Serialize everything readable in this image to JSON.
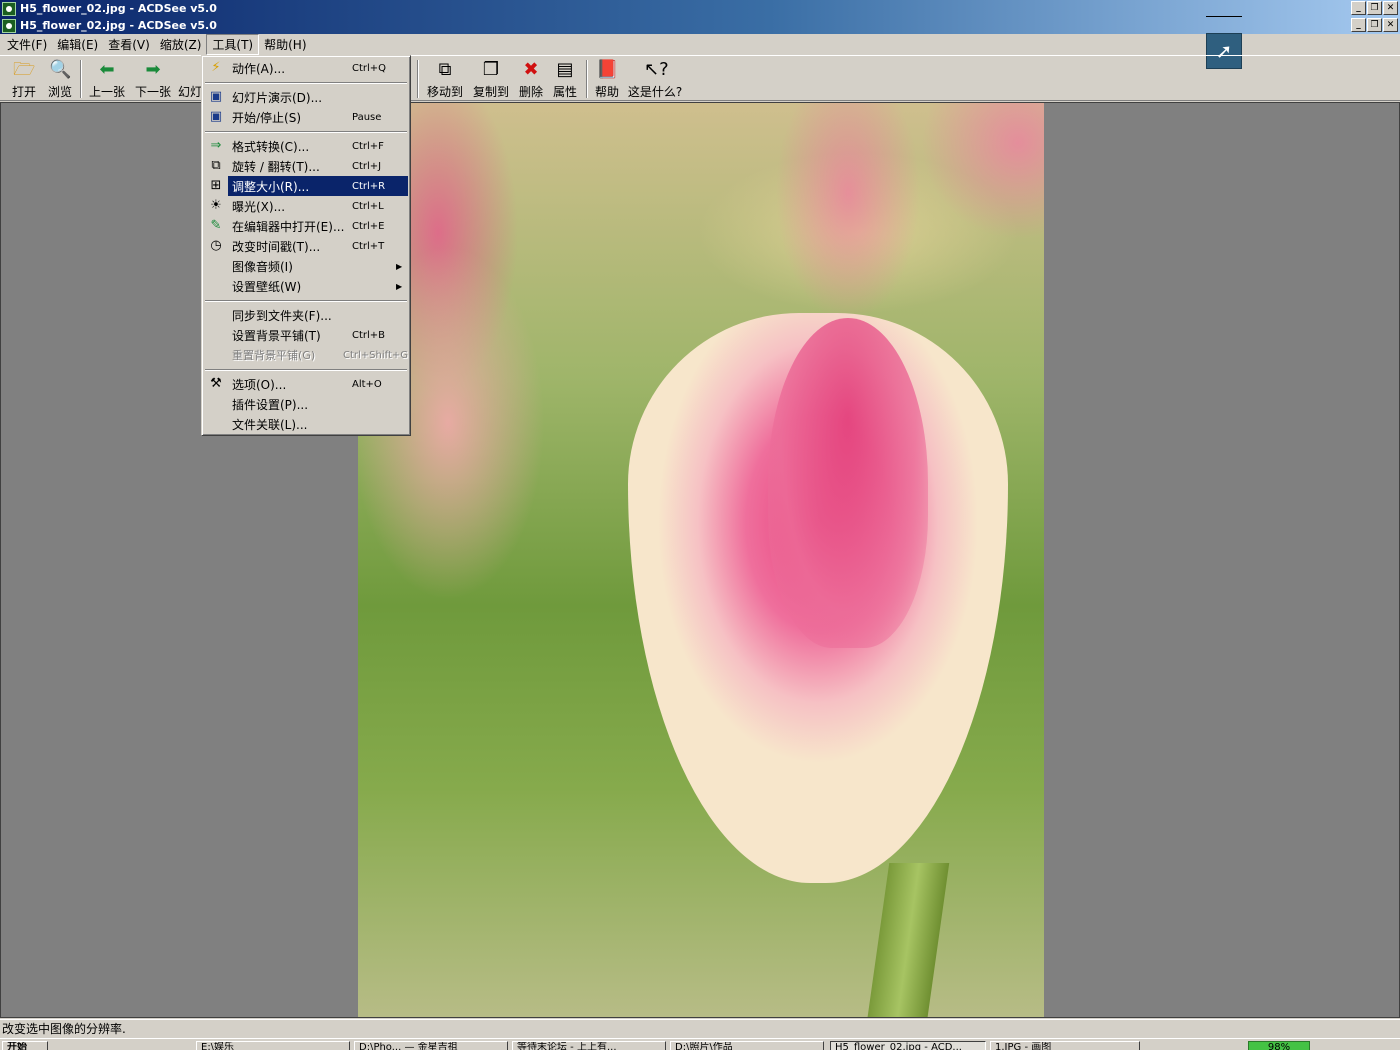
{
  "window": {
    "title_outer": "H5_flower_02.jpg - ACDSee v5.0",
    "title_inner": "H5_flower_02.jpg - ACDSee v5.0",
    "min": "_",
    "restore": "❐",
    "close": "✕"
  },
  "menubar": {
    "file": "文件(F)",
    "edit": "编辑(E)",
    "view": "查看(V)",
    "zoom": "缩放(Z)",
    "tools": "工具(T)",
    "help": "帮助(H)"
  },
  "toolbar": {
    "open": "打开",
    "browse": "浏览",
    "prev": "上一张",
    "next": "下一张",
    "slideshow": "幻灯",
    "move_to": "移动到",
    "copy_to": "复制到",
    "delete": "删除",
    "properties": "属性",
    "help": "帮助",
    "whats_this": "这是什么?"
  },
  "tools_menu": {
    "actions": {
      "label": "动作(A)...",
      "shortcut": "Ctrl+Q"
    },
    "slideshow": {
      "label": "幻灯片演示(D)...",
      "shortcut": ""
    },
    "start_stop": {
      "label": "开始/停止(S)",
      "shortcut": "Pause"
    },
    "convert": {
      "label": "格式转换(C)...",
      "shortcut": "Ctrl+F"
    },
    "rotate": {
      "label": "旋转 / 翻转(T)...",
      "shortcut": "Ctrl+J"
    },
    "resize": {
      "label": "调整大小(R)...",
      "shortcut": "Ctrl+R"
    },
    "exposure": {
      "label": "曝光(X)...",
      "shortcut": "Ctrl+L"
    },
    "open_editor": {
      "label": "在编辑器中打开(E)...",
      "shortcut": "Ctrl+E"
    },
    "timestamp": {
      "label": "改变时间戳(T)...",
      "shortcut": "Ctrl+T"
    },
    "audio": {
      "label": "图像音频(I)",
      "shortcut": ""
    },
    "wallpaper": {
      "label": "设置壁纸(W)",
      "shortcut": ""
    },
    "sync_folder": {
      "label": "同步到文件夹(F)...",
      "shortcut": ""
    },
    "set_tile": {
      "label": "设置背景平铺(T)",
      "shortcut": "Ctrl+B"
    },
    "reset_tile": {
      "label": "重置背景平铺(G)",
      "shortcut": "Ctrl+Shift+G"
    },
    "options": {
      "label": "选项(O)...",
      "shortcut": "Alt+O"
    },
    "plugins": {
      "label": "插件设置(P)...",
      "shortcut": ""
    },
    "file_assoc": {
      "label": "文件关联(L)...",
      "shortcut": ""
    }
  },
  "status": {
    "text": "改变选中图像的分辨率."
  },
  "taskbar": {
    "start": "开始",
    "task1": "E:\\娱乐",
    "task2": "D:\\Pho...  — 金星吉祖",
    "task3": "等待末论坛 - 上上有...",
    "task4": "D:\\照片\\作品",
    "task5": "H5_flower_02.jpg - ACD...",
    "task6": "1.JPG - 画图",
    "tray_value": "98%"
  },
  "colors": {
    "title_gradient_start": "#0a246a",
    "title_gradient_end": "#a6caf0",
    "menu_highlight": "#0a246a",
    "viewer_bg": "#808080",
    "chrome": "#d4d0c8"
  },
  "icons": {
    "open": "folder-open-icon",
    "browse": "browse-folder-icon",
    "prev": "arrow-left-icon",
    "next": "arrow-right-icon",
    "delete": "red-x-icon",
    "help": "book-icon"
  }
}
